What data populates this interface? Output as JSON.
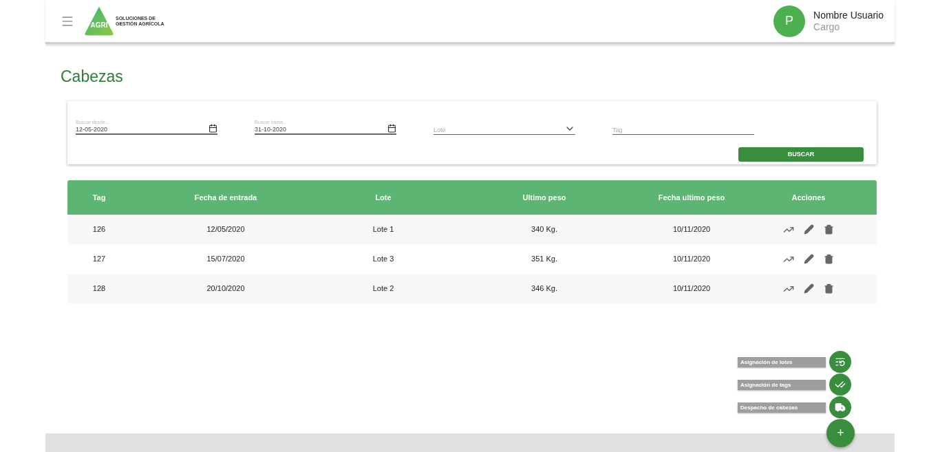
{
  "header": {
    "logo_mark": "AGRI",
    "logo_text": "SOLUCIONES DE GESTIÓN AGRÍCOLA",
    "user": {
      "initial": "P",
      "name": "Nombre Usuario",
      "role": "Cargo"
    }
  },
  "page_title": "Cabezas",
  "filters": [
    {
      "kind": "date",
      "label": "Buscar desde...",
      "value": "12-05-2020"
    },
    {
      "kind": "date",
      "label": "Buscar hasta...",
      "value": "31-10-2020"
    },
    {
      "kind": "select",
      "placeholder": "Lote"
    },
    {
      "kind": "text",
      "placeholder": "Tag"
    }
  ],
  "search_button": "BUSCAR",
  "table": {
    "columns": [
      "Tag",
      "Fecha de entrada",
      "Lote",
      "Ultimo peso",
      "Fecha ultimo peso",
      "Acciones"
    ],
    "rows": [
      [
        "126",
        "12/05/2020",
        "Lote 1",
        "340 Kg.",
        "10/11/2020"
      ],
      [
        "127",
        "15/07/2020",
        "Lote 3",
        "351 Kg.",
        "10/11/2020"
      ],
      [
        "128",
        "20/10/2020",
        "Lote 2",
        "346 Kg.",
        "10/11/2020"
      ]
    ]
  },
  "fab_actions": [
    {
      "kind": "lots",
      "label": "Asignación de lotes"
    },
    {
      "kind": "tags",
      "label": "Asignación de tags"
    },
    {
      "kind": "dispatch",
      "label": "Despacho de cabezas"
    }
  ],
  "fab_main": "+"
}
